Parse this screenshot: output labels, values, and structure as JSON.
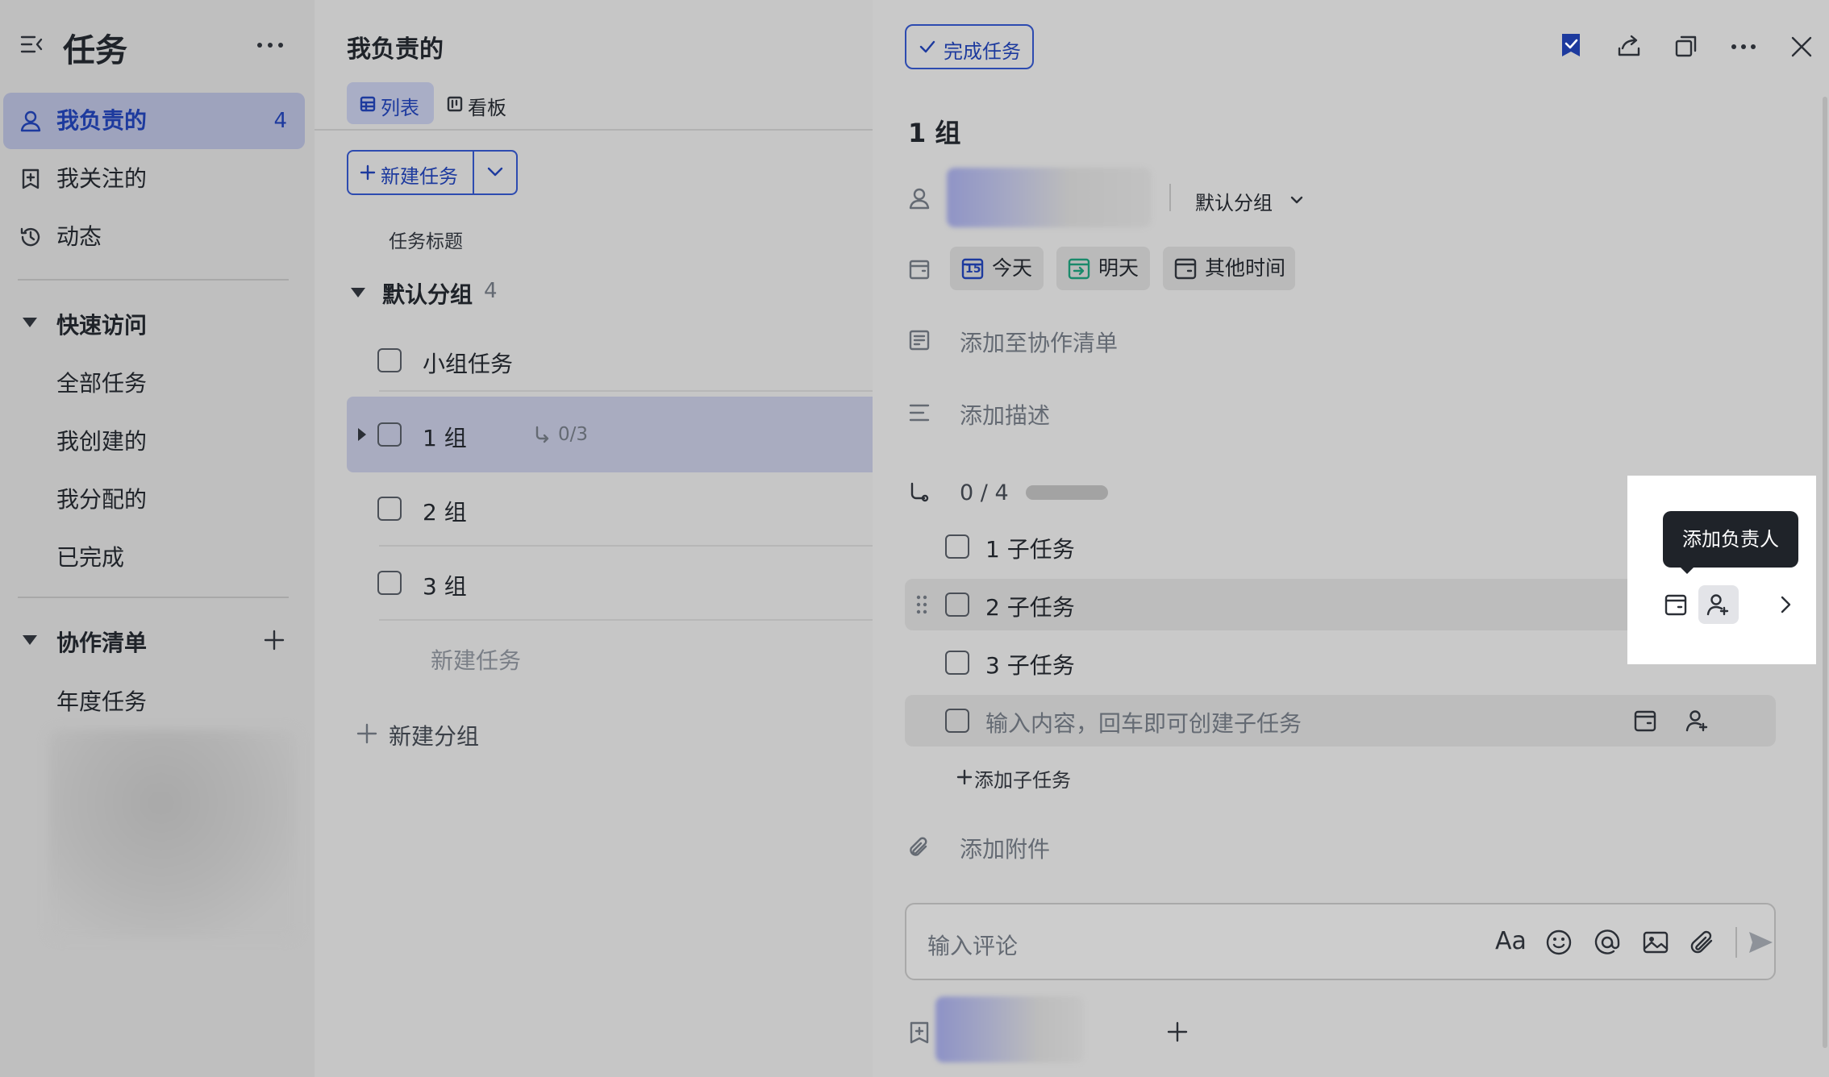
{
  "sidebar": {
    "title": "任务",
    "nav": [
      {
        "label": "我负责的",
        "count": "4"
      },
      {
        "label": "我关注的"
      },
      {
        "label": "动态"
      }
    ],
    "quick_access": {
      "title": "快速访问",
      "items": [
        "全部任务",
        "我创建的",
        "我分配的",
        "已完成"
      ]
    },
    "collab": {
      "title": "协作清单",
      "items": [
        "年度任务"
      ]
    }
  },
  "list": {
    "title": "我负责的",
    "tabs": [
      "列表",
      "看板"
    ],
    "new_task_btn": "新建任务",
    "column_header": "任务标题",
    "group": {
      "name": "默认分组",
      "count": "4"
    },
    "rows": [
      {
        "label": "小组任务"
      },
      {
        "label": "1 组",
        "subtask": "0/3"
      },
      {
        "label": "2 组"
      },
      {
        "label": "3 组"
      }
    ],
    "new_task_placeholder": "新建任务",
    "new_group": "新建分组"
  },
  "detail": {
    "complete_btn": "完成任务",
    "title": "1 组",
    "group_select": "默认分组",
    "dates": [
      "今天",
      "明天",
      "其他时间"
    ],
    "calendar_day": "15",
    "add_to_list": "添加至协作清单",
    "add_desc": "添加描述",
    "subtask_progress": "0 / 4",
    "subtask_progress_fraction": 0,
    "subtasks": [
      "1 子任务",
      "2 子任务",
      "3 子任务"
    ],
    "subtask_input_placeholder": "输入内容，回车即可创建子任务",
    "add_subtask": "添加子任务",
    "add_attachment": "添加附件",
    "tooltip": "添加负责人",
    "comment_placeholder": "输入评论",
    "format_label": "Aa"
  }
}
